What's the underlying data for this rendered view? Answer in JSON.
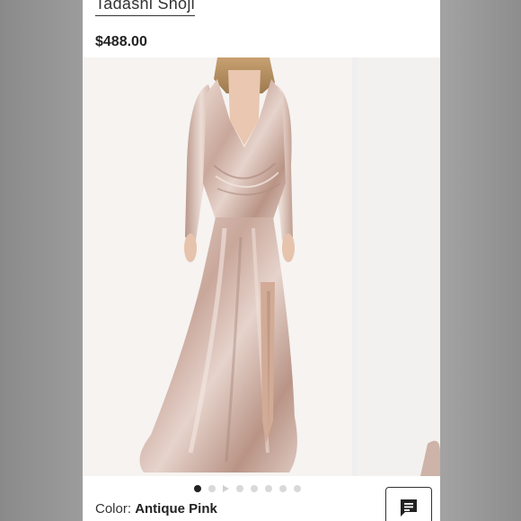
{
  "product": {
    "brand": "Tadashi Shoji",
    "price": "$488.00",
    "color_label": "Color:",
    "color_value": "Antique Pink"
  },
  "gallery": {
    "slide_count": 8,
    "active_index": 0,
    "video_index": 2
  },
  "colors": {
    "dress": "#d7b9ad",
    "page_bg": "#ffffff",
    "text": "#222222"
  },
  "icons": {
    "chat": "chat-icon"
  }
}
